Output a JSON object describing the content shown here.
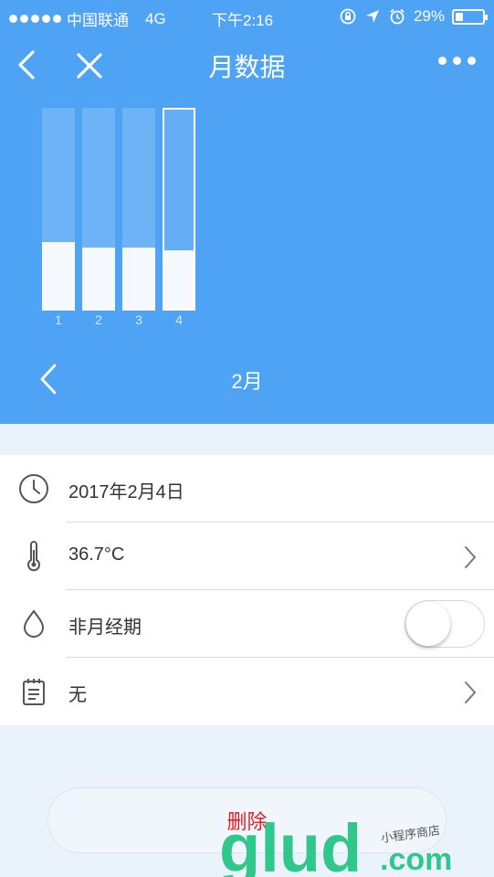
{
  "status_bar": {
    "carrier": "中国联通",
    "network": "4G",
    "time": "下午2:16",
    "battery": "29%",
    "battery_level": 0.29
  },
  "nav": {
    "title": "月数据"
  },
  "chart_data": {
    "type": "bar",
    "categories": [
      "1",
      "2",
      "3",
      "4"
    ],
    "values": [
      0.34,
      0.31,
      0.31,
      0.29
    ],
    "selected_index": 3,
    "ylim": [
      0,
      1
    ]
  },
  "month_selector": {
    "label": "2月"
  },
  "record": {
    "date": "2017年2月4日",
    "temperature": "36.7°C",
    "period_status": "非月经期",
    "period_toggle_on": false,
    "note": "无"
  },
  "actions": {
    "delete_label": "删除"
  },
  "watermark": {
    "text_main": "glud",
    "text_suffix": ".com",
    "text_small": "小程序商店"
  },
  "colors": {
    "header_blue": "#4fa3f5",
    "delete_red": "#e02020",
    "page_bg": "#eaf3fb"
  }
}
